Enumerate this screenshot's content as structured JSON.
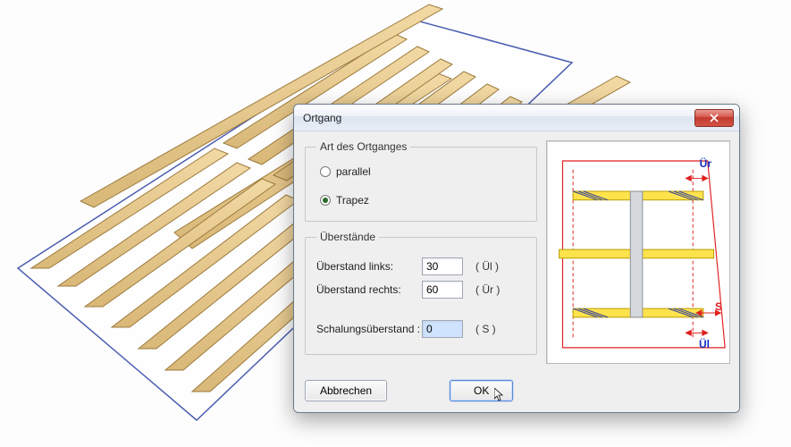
{
  "dialog": {
    "title": "Ortgang",
    "group_art": {
      "legend": "Art des Ortganges",
      "option_parallel": "parallel",
      "option_trapez": "Trapez",
      "selected": "trapez"
    },
    "group_ub": {
      "legend": "Überstände",
      "row_links": {
        "label": "Überstand links:",
        "value": "30",
        "ann": "( Ül )"
      },
      "row_rechts": {
        "label": "Überstand rechts:",
        "value": "60",
        "ann": "( Ür )"
      },
      "row_schal": {
        "label": "Schalungsüberstand :",
        "value": "0",
        "ann": "( S )"
      }
    },
    "buttons": {
      "cancel": "Abbrechen",
      "ok": "OK"
    },
    "diagram": {
      "label_ur": "Ür",
      "label_s": "S",
      "label_ul": "Ül"
    }
  }
}
